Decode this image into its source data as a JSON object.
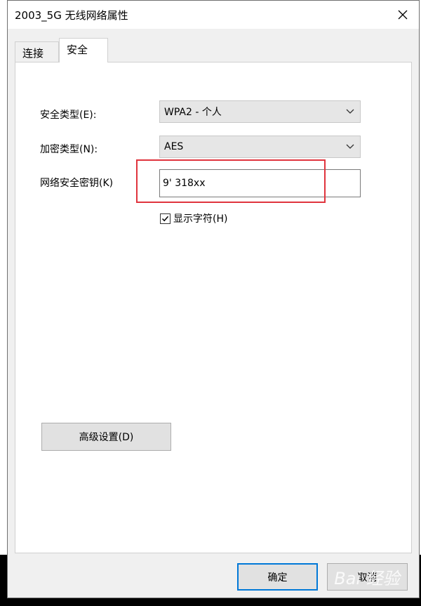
{
  "window": {
    "title": "2003_5G 无线网络属性"
  },
  "tabs": [
    {
      "label": "连接"
    },
    {
      "label": "安全"
    }
  ],
  "security": {
    "security_type_label": "安全类型(E):",
    "security_type_value": "WPA2 - 个人",
    "encryption_type_label": "加密类型(N):",
    "encryption_type_value": "AES",
    "key_label": "网络安全密钥(K)",
    "key_value": "9' 318xx",
    "show_chars_label": "显示字符(H)",
    "show_chars_checked": true
  },
  "buttons": {
    "advanced": "高级设置(D)",
    "ok": "确定",
    "cancel": "取消"
  },
  "watermark": "Bai 经验",
  "colors": {
    "highlight": "#e0343d",
    "focus": "#0078d7"
  }
}
